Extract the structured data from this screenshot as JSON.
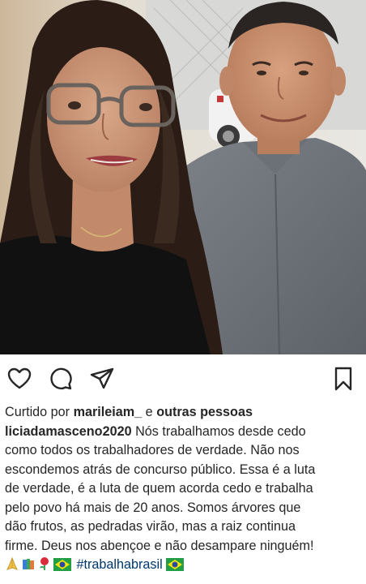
{
  "post": {
    "photo": {
      "icon": "photo-couple"
    },
    "actions": {
      "like_icon": "heart-icon",
      "comment_icon": "comment-icon",
      "share_icon": "share-icon",
      "save_icon": "bookmark-icon"
    },
    "likes": {
      "prefix": "Curtido por",
      "user": "marileiam_",
      "connector": "e",
      "rest": "outras pessoas"
    },
    "caption": {
      "username": "liciadamasceno2020",
      "lines": [
        "Nós trabalhamos desde cedo",
        "como todos os trabalhadores de verdade. Não nos",
        "escondemos atrás de concurso público. Essa é a luta",
        "de verdade, é a luta de quem acorda cedo e trabalha",
        "pelo povo há mais de 20 anos. Somos árvores que",
        "dão frutos, as pedradas virão, mas a raiz continua",
        "firme. Deus nos abençoe e não desampare ninguém!"
      ],
      "emojis_before": [
        "folded-hands-emoji",
        "books-emoji",
        "rose-emoji",
        "brazil-flag-emoji"
      ],
      "hashtag": "#trabalhabrasil",
      "emojis_after": [
        "brazil-flag-emoji"
      ]
    },
    "colors": {
      "text": "#262626",
      "hashtag": "#00376b",
      "icon_stroke": "#262626",
      "background": "#ffffff"
    }
  }
}
